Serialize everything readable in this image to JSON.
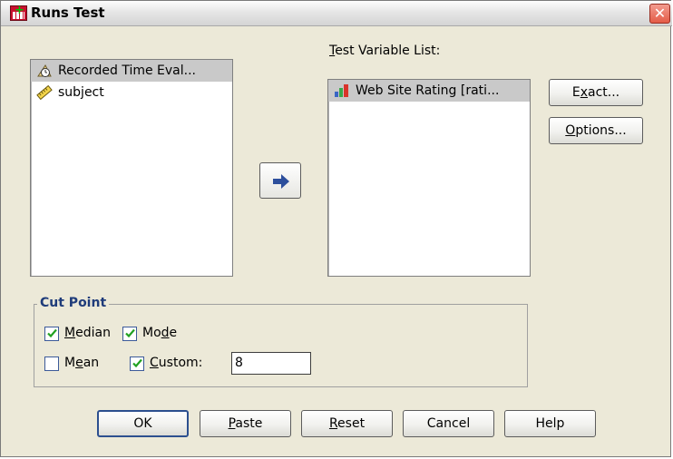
{
  "window": {
    "title": "Runs Test",
    "close_glyph": "✕"
  },
  "source_list": {
    "items": [
      {
        "label": "Recorded Time Eval...",
        "icon": "scale-clock-icon",
        "selected": true
      },
      {
        "label": "subject",
        "icon": "ruler-icon",
        "selected": false
      }
    ]
  },
  "test_variable": {
    "label_pre": "",
    "label_mnemonic": "T",
    "label_post": "est Variable List:",
    "items": [
      {
        "label": "Web Site Rating [rati...",
        "icon": "bar-chart-icon",
        "selected": true
      }
    ]
  },
  "buttons": {
    "exact": {
      "pre": "E",
      "mnemonic": "x",
      "post": "act..."
    },
    "options": {
      "pre": "",
      "mnemonic": "O",
      "post": "ptions..."
    },
    "ok": {
      "pre": "OK",
      "mnemonic": "",
      "post": ""
    },
    "paste": {
      "pre": "",
      "mnemonic": "P",
      "post": "aste"
    },
    "reset": {
      "pre": "",
      "mnemonic": "R",
      "post": "eset"
    },
    "cancel": {
      "pre": "Cancel",
      "mnemonic": "",
      "post": ""
    },
    "help": {
      "pre": "Help",
      "mnemonic": "",
      "post": ""
    }
  },
  "cut_point": {
    "title": "Cut Point",
    "median": {
      "pre": "",
      "mnemonic": "M",
      "post": "edian",
      "checked": true
    },
    "mode": {
      "pre": "Mo",
      "mnemonic": "d",
      "post": "e",
      "checked": true
    },
    "mean": {
      "pre": "M",
      "mnemonic": "e",
      "post": "an",
      "checked": false
    },
    "custom": {
      "pre": "",
      "mnemonic": "C",
      "post": "ustom:",
      "checked": true
    },
    "custom_value": "8"
  },
  "colors": {
    "accent": "#2c4f8f",
    "legend": "#1f3c7a",
    "selection": "#c9c9c9"
  }
}
